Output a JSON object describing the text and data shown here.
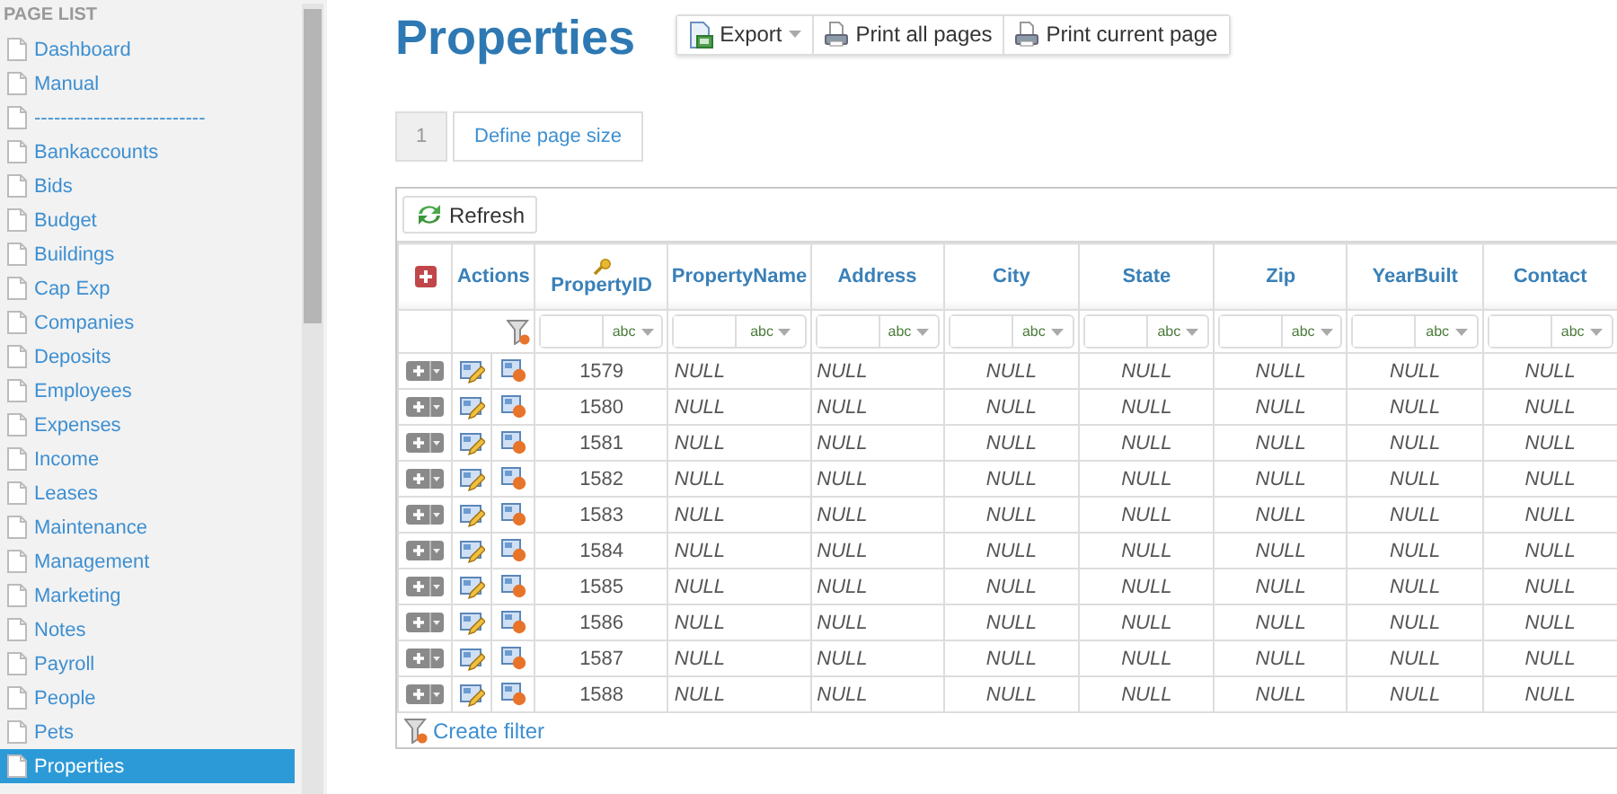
{
  "sidebar": {
    "heading": "PAGE LIST",
    "items": [
      {
        "label": "Dashboard",
        "selected": false
      },
      {
        "label": "Manual",
        "selected": false
      },
      {
        "label": "--------------------------",
        "selected": false
      },
      {
        "label": "Bankaccounts",
        "selected": false
      },
      {
        "label": "Bids",
        "selected": false
      },
      {
        "label": "Budget",
        "selected": false
      },
      {
        "label": "Buildings",
        "selected": false
      },
      {
        "label": "Cap Exp",
        "selected": false
      },
      {
        "label": "Companies",
        "selected": false
      },
      {
        "label": "Deposits",
        "selected": false
      },
      {
        "label": "Employees",
        "selected": false
      },
      {
        "label": "Expenses",
        "selected": false
      },
      {
        "label": "Income",
        "selected": false
      },
      {
        "label": "Leases",
        "selected": false
      },
      {
        "label": "Maintenance",
        "selected": false
      },
      {
        "label": "Management",
        "selected": false
      },
      {
        "label": "Marketing",
        "selected": false
      },
      {
        "label": "Notes",
        "selected": false
      },
      {
        "label": "Payroll",
        "selected": false
      },
      {
        "label": "People",
        "selected": false
      },
      {
        "label": "Pets",
        "selected": false
      },
      {
        "label": "Properties",
        "selected": true
      }
    ]
  },
  "page": {
    "title": "Properties",
    "toolbar": [
      {
        "label": "Export",
        "kind": "export"
      },
      {
        "label": "Print all pages",
        "kind": "print"
      },
      {
        "label": "Print current page",
        "kind": "print"
      }
    ]
  },
  "pager": {
    "pages": [
      {
        "label": "1",
        "selected": true
      }
    ],
    "size_button": "Define page size"
  },
  "grid": {
    "refresh": "Refresh",
    "actions_heading": "Actions",
    "columns": [
      {
        "label": "PropertyID",
        "key": true
      },
      {
        "label": "PropertyName",
        "key": false
      },
      {
        "label": "Address",
        "key": false
      },
      {
        "label": "City",
        "key": false
      },
      {
        "label": "State",
        "key": false
      },
      {
        "label": "Zip",
        "key": false
      },
      {
        "label": "YearBuilt",
        "key": false
      },
      {
        "label": "Contact",
        "key": false
      }
    ],
    "filters": [
      {
        "type": "abc"
      },
      {
        "type": "abc"
      },
      {
        "type": "abc"
      },
      {
        "type": "abc"
      },
      {
        "type": "abc"
      },
      {
        "type": "abc"
      },
      {
        "type": "abc"
      },
      {
        "type": "abc"
      }
    ],
    "rows": [
      {
        "cells": [
          "1579",
          "NULL",
          "NULL",
          "NULL",
          "NULL",
          "NULL",
          "NULL",
          "NULL"
        ]
      },
      {
        "cells": [
          "1580",
          "NULL",
          "NULL",
          "NULL",
          "NULL",
          "NULL",
          "NULL",
          "NULL"
        ]
      },
      {
        "cells": [
          "1581",
          "NULL",
          "NULL",
          "NULL",
          "NULL",
          "NULL",
          "NULL",
          "NULL"
        ]
      },
      {
        "cells": [
          "1582",
          "NULL",
          "NULL",
          "NULL",
          "NULL",
          "NULL",
          "NULL",
          "NULL"
        ]
      },
      {
        "cells": [
          "1583",
          "NULL",
          "NULL",
          "NULL",
          "NULL",
          "NULL",
          "NULL",
          "NULL"
        ]
      },
      {
        "cells": [
          "1584",
          "NULL",
          "NULL",
          "NULL",
          "NULL",
          "NULL",
          "NULL",
          "NULL"
        ]
      },
      {
        "cells": [
          "1585",
          "NULL",
          "NULL",
          "NULL",
          "NULL",
          "NULL",
          "NULL",
          "NULL"
        ]
      },
      {
        "cells": [
          "1586",
          "NULL",
          "NULL",
          "NULL",
          "NULL",
          "NULL",
          "NULL",
          "NULL"
        ]
      },
      {
        "cells": [
          "1587",
          "NULL",
          "NULL",
          "NULL",
          "NULL",
          "NULL",
          "NULL",
          "NULL"
        ]
      },
      {
        "cells": [
          "1588",
          "NULL",
          "NULL",
          "NULL",
          "NULL",
          "NULL",
          "NULL",
          "NULL"
        ]
      }
    ],
    "create_filter": "Create filter"
  }
}
